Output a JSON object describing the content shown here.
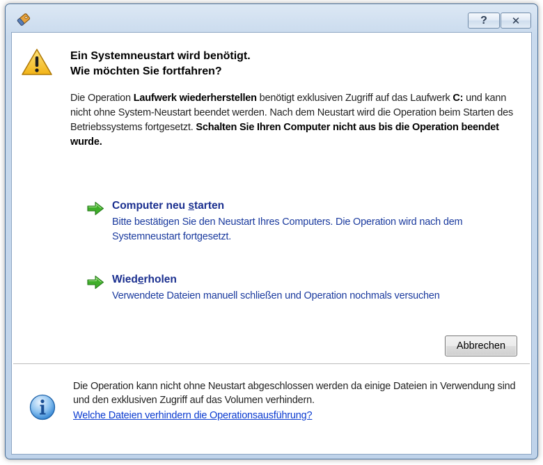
{
  "titlebar": {
    "help_label": "?",
    "close_label": "✕",
    "app_icon": "tag-icon"
  },
  "headline": {
    "line1": "Ein Systemneustart wird benötigt.",
    "line2": "Wie möchten Sie fortfahren?"
  },
  "description": {
    "t1": "Die Operation ",
    "b1": "Laufwerk wiederherstellen",
    "t2": " benötigt exklusiven Zugriff auf das Laufwerk ",
    "b2": "C:",
    "t3": " und kann nicht ohne System-Neustart beendet werden. Nach dem Neustart wird die Operation beim Starten des Betriebssystems fortgesetzt. ",
    "b3": "Schalten Sie Ihren Computer nicht aus bis die Operation beendet wurde."
  },
  "commands": [
    {
      "title_pre": "Computer neu ",
      "title_access": "s",
      "title_post": "tarten",
      "description": "Bitte bestätigen Sie den Neustart Ihres Computers. Die Operation wird nach dem Systemneustart fortgesetzt.",
      "icon": "green-arrow-icon"
    },
    {
      "title_pre": "Wied",
      "title_access": "e",
      "title_post": "rholen",
      "description": "Verwendete Dateien manuell schließen und Operation nochmals versuchen",
      "icon": "green-arrow-icon"
    }
  ],
  "buttons": {
    "cancel_label": "Abbrechen"
  },
  "footer": {
    "text": "Die Operation kann nicht ohne Neustart abgeschlossen werden da einige Dateien in Verwendung sind und den exklusiven Zugriff auf das Volumen verhindern.",
    "link": "Welche Dateien verhindern die Operationsausführung?"
  },
  "colors": {
    "command_title": "#1a2f8f",
    "command_text": "#1a3a9e",
    "link": "#0b3bd0",
    "arrow_green": "#3fae2a",
    "warning_yellow": "#f7c928",
    "info_blue": "#2a7fd0"
  }
}
